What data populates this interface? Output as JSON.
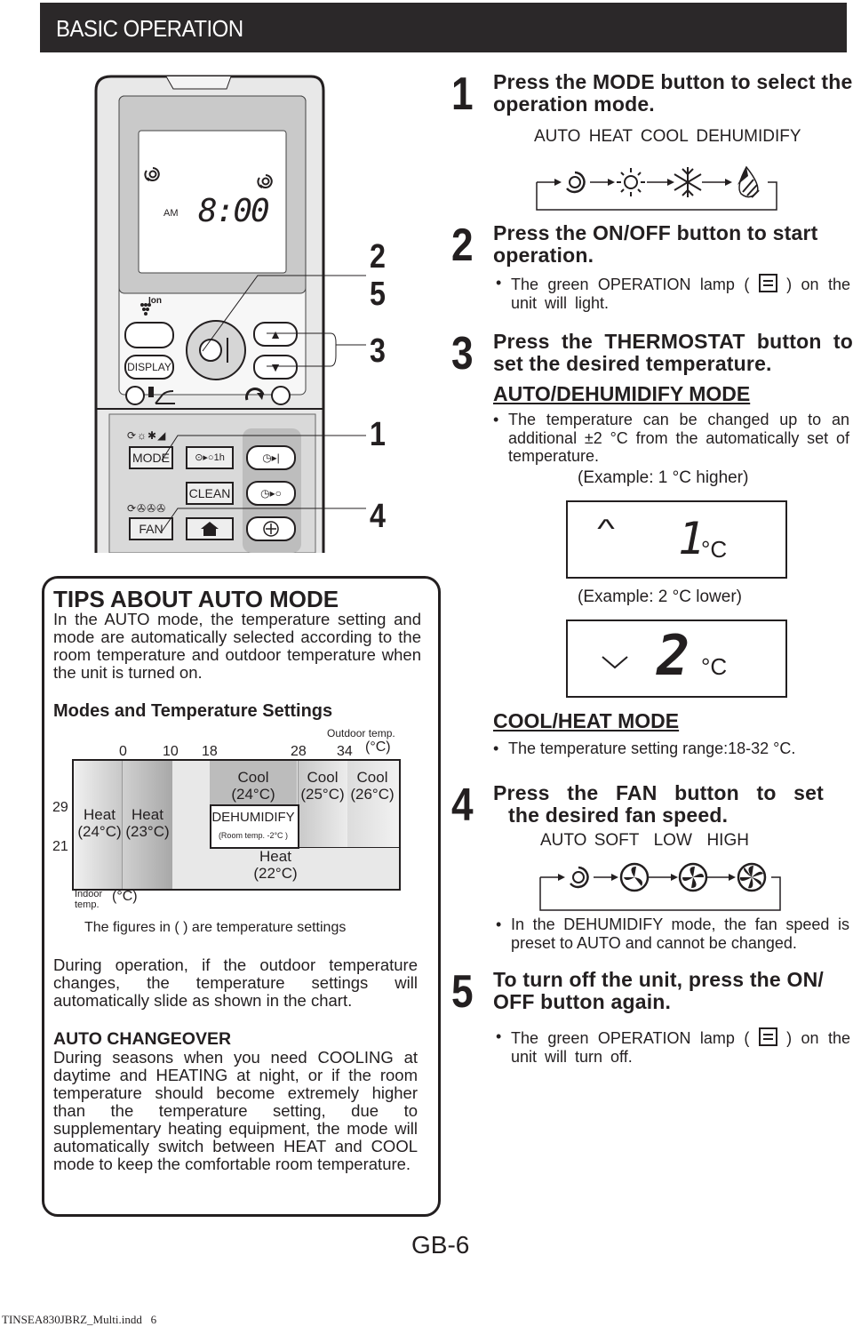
{
  "header": {
    "title": "BASIC OPERATION"
  },
  "remote": {
    "lcd": {
      "am": "AM",
      "time": "8:00"
    },
    "ion_label": "Ion",
    "buttons": {
      "display": "DISPLAY",
      "mode": "MODE",
      "timer_1h": "⊙▸○1h",
      "clean": "CLEAN",
      "fan": "FAN"
    },
    "callouts": [
      "2",
      "5",
      "3",
      "1",
      "4"
    ]
  },
  "steps": [
    {
      "number": "1",
      "heading": "Press the MODE button to select the operation mode.",
      "cycle_labels": [
        "AUTO",
        "HEAT",
        "COOL",
        "DEHUMIDIFY"
      ],
      "cycle_icons": [
        "auto-swirl-icon",
        "sun-icon",
        "snowflake-icon",
        "droplet-icon"
      ]
    },
    {
      "number": "2",
      "heading": "Press the ON/OFF button to start operation.",
      "bullet_before": "The green OPERATION lamp (",
      "bullet_after": ") on the unit will light."
    },
    {
      "number": "3",
      "heading": "Press the THERMOSTAT button to set the desired temperature.",
      "auto_mode_heading": "AUTO/DEHUMIDIFY MODE",
      "auto_bullet": "The temperature can be changed up to an additional ±2 °C from the automatically set of temperature.",
      "example1_caption": "(Example: 1 °C higher)",
      "example1_digit": "1",
      "example1_unit": "°C",
      "example2_caption": "(Example: 2 °C lower)",
      "example2_digit": "2",
      "example2_unit": "°C",
      "coolheat_heading": "COOL/HEAT MODE",
      "coolheat_bullet": "The temperature setting range:18-32 °C."
    },
    {
      "number": "4",
      "heading_line1": "Press the FAN button to set",
      "heading_line2": "the desired fan speed.",
      "cycle_labels": [
        "AUTO",
        "SOFT",
        "LOW",
        "HIGH"
      ],
      "bullet": "In the DEHUMIDIFY mode, the fan speed is preset to AUTO and cannot be changed."
    },
    {
      "number": "5",
      "heading": "To turn off the unit, press the ON/ OFF button again.",
      "bullet_before": "The green OPERATION lamp (",
      "bullet_after": ") on the unit will turn off."
    }
  ],
  "tips": {
    "title": "TIPS ABOUT AUTO MODE",
    "intro": "In the AUTO mode, the temperature setting and mode are automatically selected according to the room temperature and outdoor temperature when the unit is turned on.",
    "chart_title": "Modes and Temperature Settings",
    "chart_note": "The figures in (  ) are temperature settings",
    "slide_text": "During operation, if the outdoor temperature changes, the temperature settings will automatically slide as shown in the chart.",
    "changeover_title": "AUTO CHANGEOVER",
    "changeover_text": "During seasons when you need COOLING at daytime and HEATING at night, or if the room temperature should become extremely higher than the temperature setting, due to supplementary heating equipment, the mode will automatically switch between HEAT and COOL mode to keep the comfortable room temperature."
  },
  "chart_data": {
    "type": "table",
    "title": "Modes and Temperature Settings",
    "xlabel": "Outdoor temp.",
    "x_unit": "(°C)",
    "ylabel": "Indoor temp.",
    "y_unit": "(°C)",
    "x_ticks": [
      0,
      10,
      18,
      28,
      34
    ],
    "y_ticks": [
      29,
      21
    ],
    "regions": [
      {
        "mode": "Heat",
        "setting": "(24°C)",
        "outdoor": "< 0",
        "indoor": "all"
      },
      {
        "mode": "Heat",
        "setting": "(23°C)",
        "outdoor": "0–10",
        "indoor": "all"
      },
      {
        "mode": "Cool",
        "setting": "(24°C)",
        "outdoor": "18–28",
        "indoor": "> 29"
      },
      {
        "mode": "Cool",
        "setting": "(25°C)",
        "outdoor": "28–34",
        "indoor": "> 21"
      },
      {
        "mode": "Cool",
        "setting": "(26°C)",
        "outdoor": "> 34",
        "indoor": "> 21"
      },
      {
        "mode": "DEHUMIDIFY",
        "setting": "(Room temp. -2°C )",
        "outdoor": "18–28",
        "indoor": "21–29"
      },
      {
        "mode": "Heat",
        "setting": "(22°C)",
        "outdoor": "> 10",
        "indoor": "< 21"
      }
    ]
  },
  "footer": {
    "page": "GB-6",
    "file": "TINSEA830JBRZ_Multi.indd   6"
  }
}
